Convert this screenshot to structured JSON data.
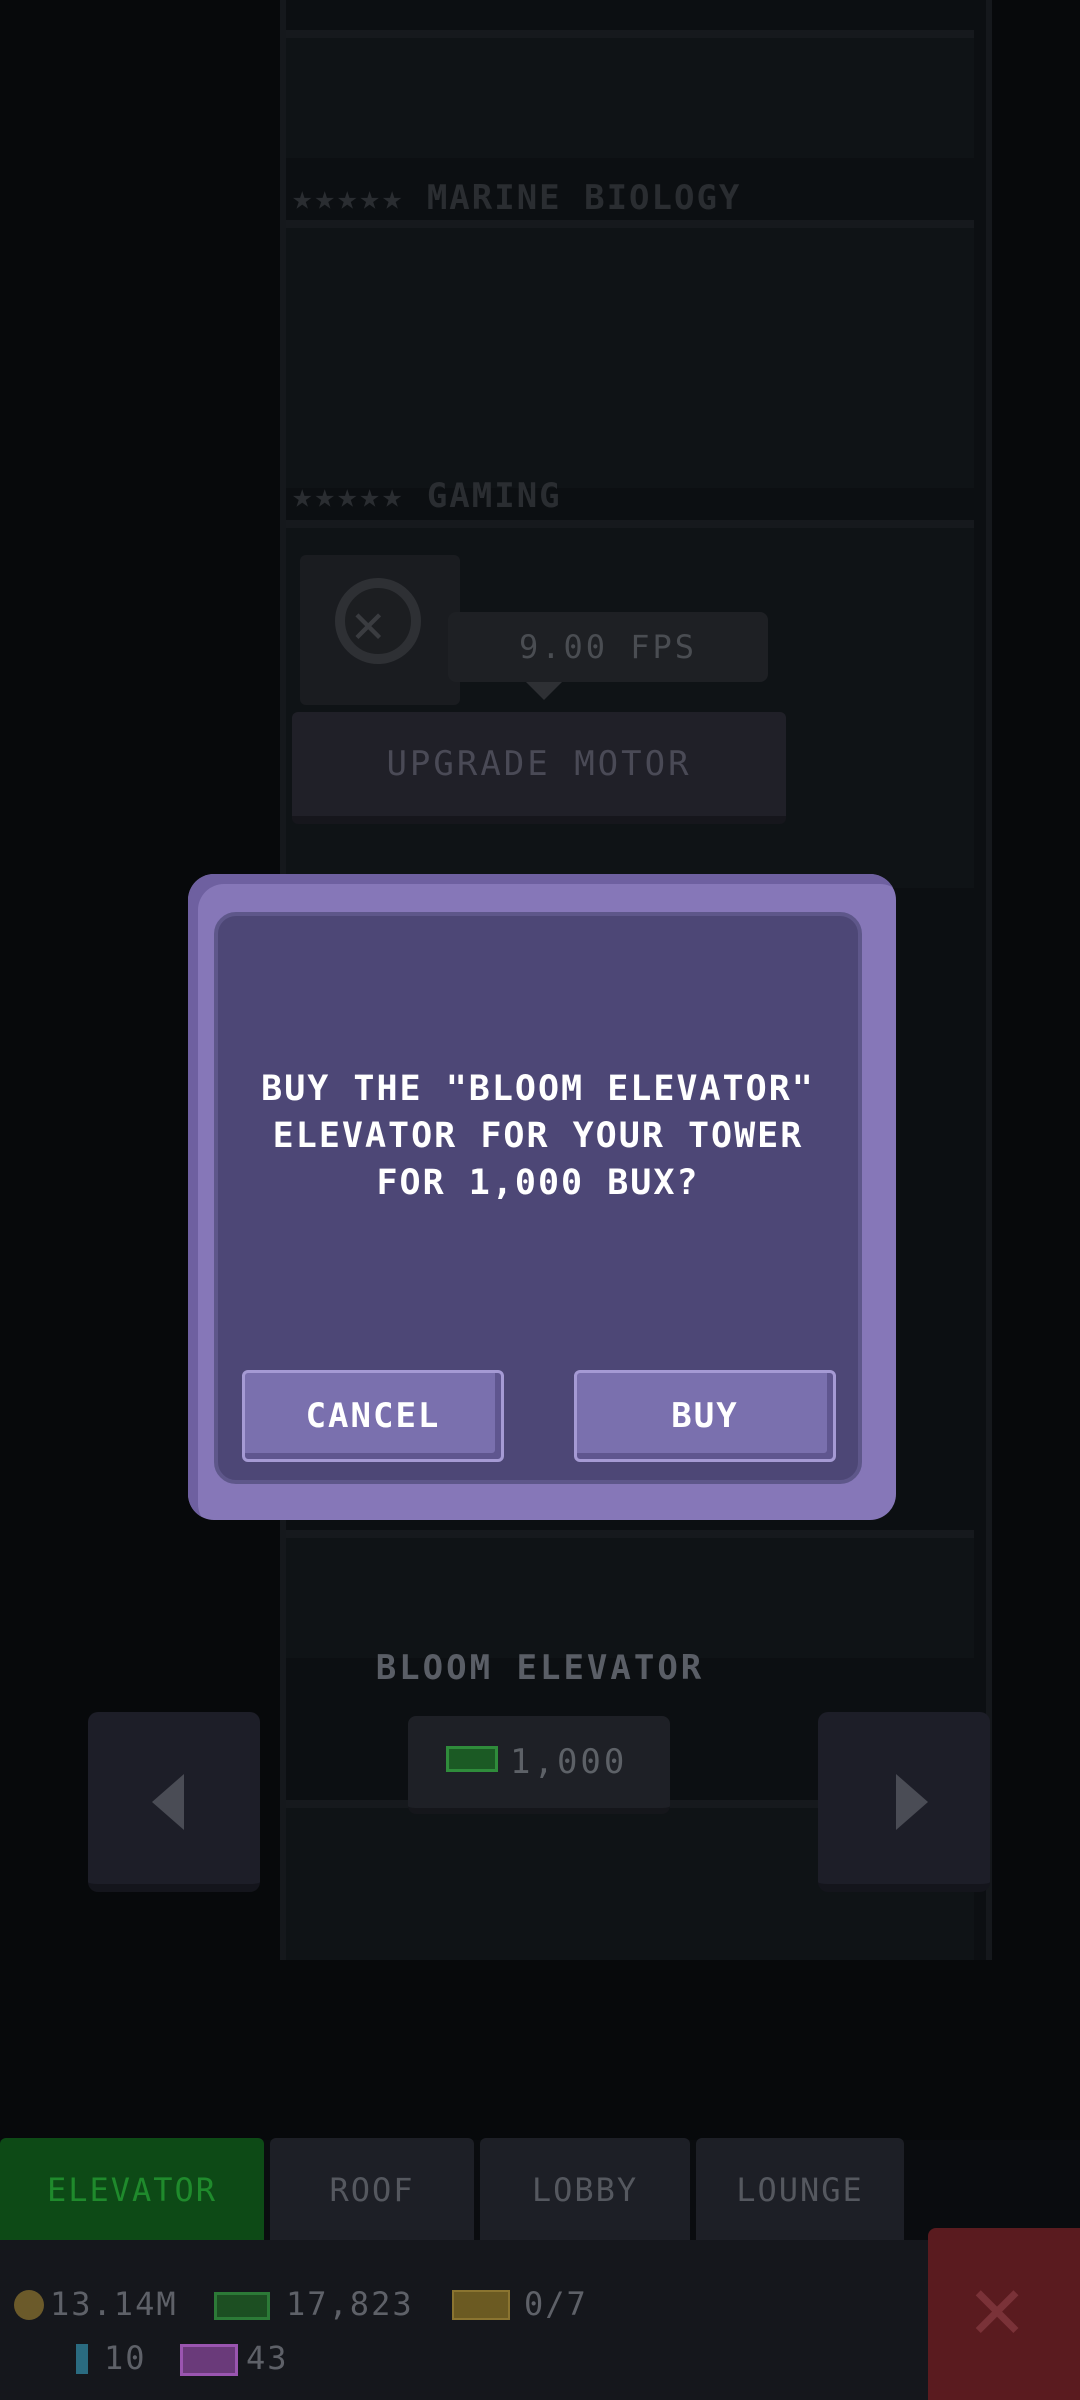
{
  "background": {
    "floors": [
      {
        "label": "★★★★★ MARINE BIOLOGY"
      },
      {
        "label": "★★★★★ GAMING"
      }
    ],
    "fps_readout": "9.00 FPS",
    "upgrade_button": "UPGRADE MOTOR"
  },
  "dialog": {
    "message_line1": "BUY THE \"BLOOM ELEVATOR\"",
    "message_line2": "ELEVATOR FOR YOUR TOWER",
    "message_line3": "FOR 1,000 BUX?",
    "cancel_label": "CANCEL",
    "buy_label": "BUY"
  },
  "picker": {
    "elevator_name": "BLOOM ELEVATOR",
    "price": "1,000",
    "prev_icon": "chevron-left-icon",
    "next_icon": "chevron-right-icon"
  },
  "tabs": [
    {
      "label": "ELEVATOR",
      "active": true
    },
    {
      "label": "ROOF",
      "active": false
    },
    {
      "label": "LOBBY",
      "active": false
    },
    {
      "label": "LOUNGE",
      "active": false
    }
  ],
  "status": {
    "coins": "13.14M",
    "bux": "17,823",
    "tickets": "0/7",
    "gems": "10",
    "tv": "43"
  },
  "colors": {
    "dialog_border": "#8677b8",
    "dialog_fill": "#4d4776",
    "button_fill": "#7a70ae",
    "active_tab": "#0d4a16",
    "close_button": "#5a1b1f"
  }
}
